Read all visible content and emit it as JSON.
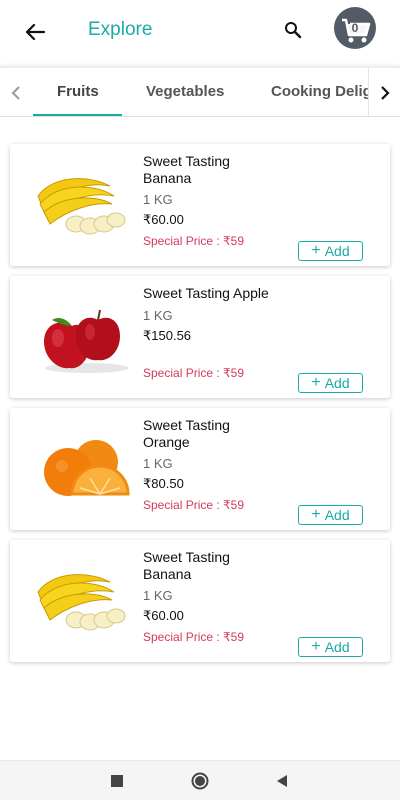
{
  "header": {
    "title": "Explore",
    "cart_count": "0"
  },
  "tabs": [
    {
      "label": "Fruits"
    },
    {
      "label": "Vegetables"
    },
    {
      "label": "Cooking Delig"
    }
  ],
  "products": [
    {
      "name": "Sweet Tasting Banana",
      "qty": "1 KG",
      "price": "₹60.00",
      "special": "Special Price : ₹59",
      "add_label": "Add",
      "image": "banana"
    },
    {
      "name": "Sweet Tasting Apple",
      "qty": "1 KG",
      "price": "₹150.56",
      "special": "Special Price : ₹59",
      "add_label": "Add",
      "image": "apple"
    },
    {
      "name": "Sweet Tasting Orange",
      "qty": "1 KG",
      "price": "₹80.50",
      "special": "Special Price : ₹59",
      "add_label": "Add",
      "image": "orange"
    },
    {
      "name": "Sweet Tasting Banana",
      "qty": "1 KG",
      "price": "₹60.00",
      "special": "Special Price : ₹59",
      "add_label": "Add",
      "image": "banana"
    }
  ],
  "colors": {
    "accent": "#1aaba7",
    "special_price": "#d33a5d",
    "cart_bg": "#535b66"
  },
  "icons": [
    "arrow-left-icon",
    "search-icon",
    "cart-icon",
    "chevron-left-icon",
    "chevron-right-icon",
    "square-icon",
    "circle-icon",
    "triangle-back-icon"
  ]
}
